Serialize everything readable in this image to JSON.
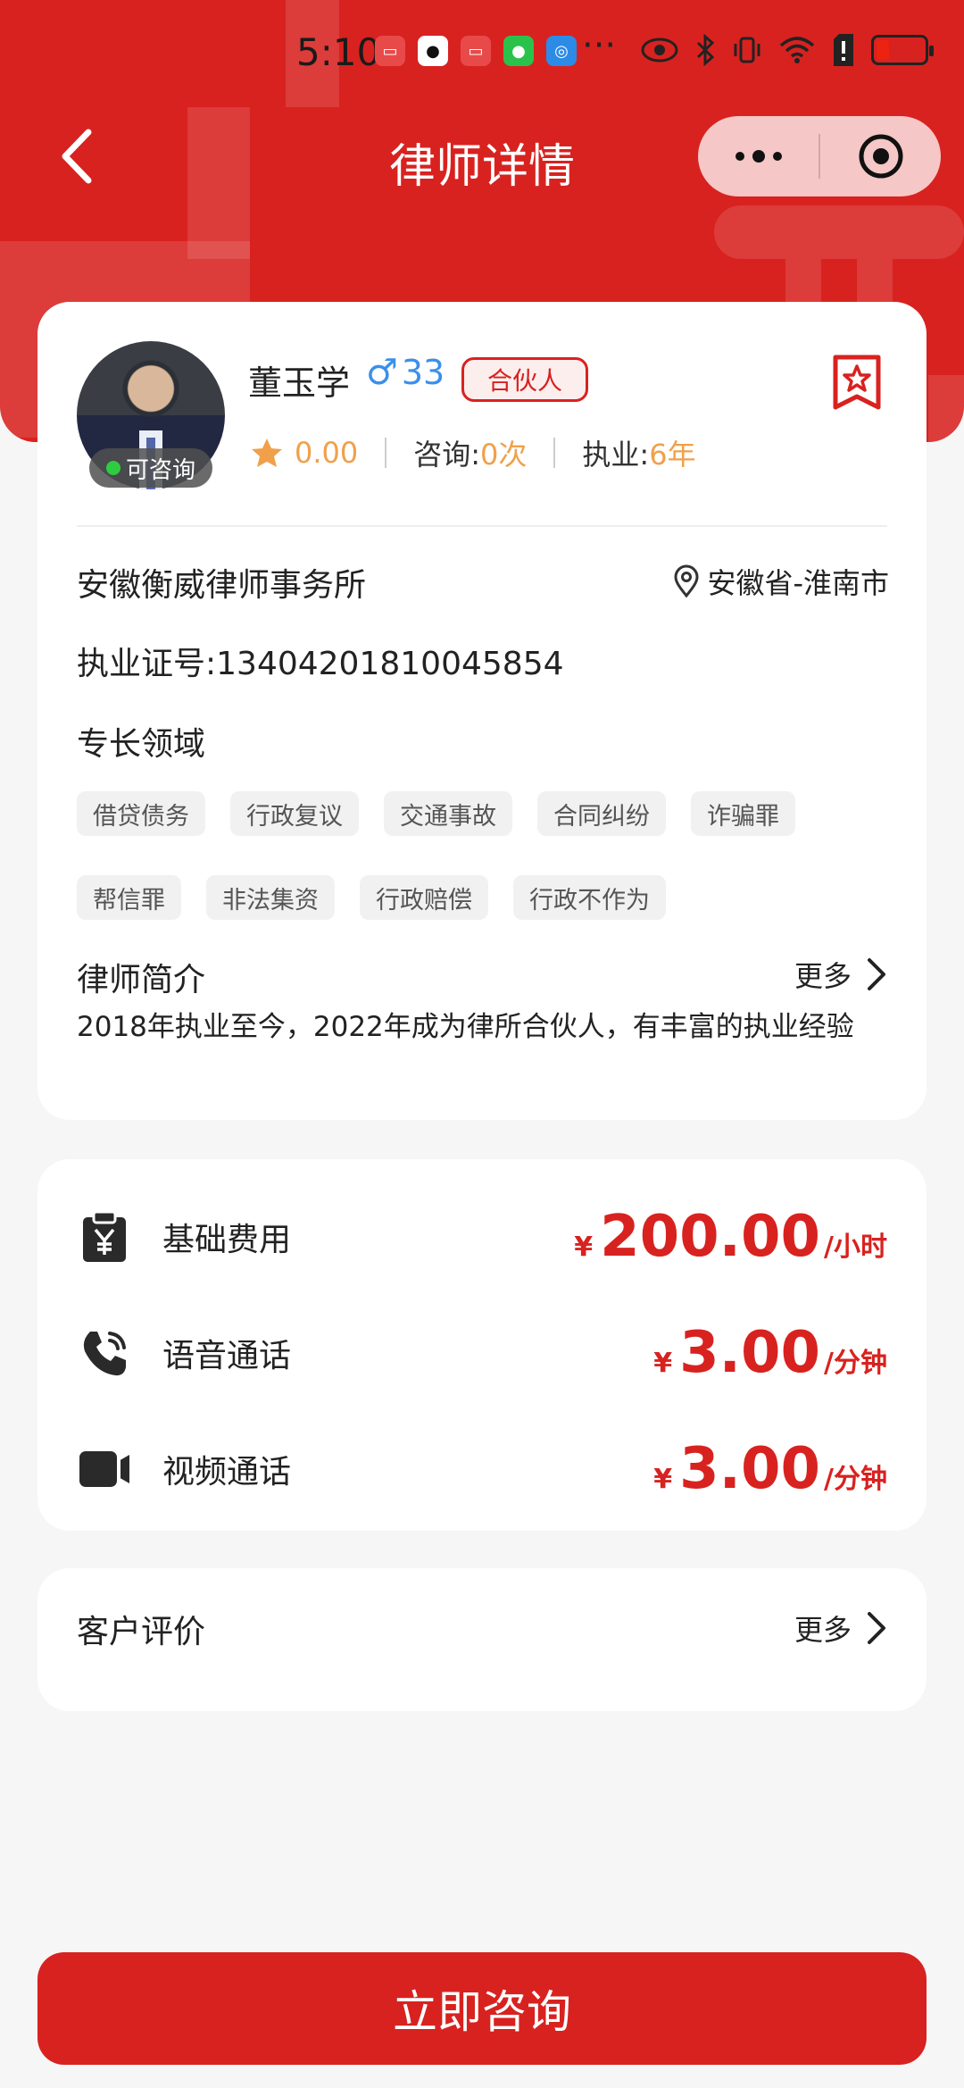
{
  "status_bar": {
    "time": "5:10",
    "more": "···"
  },
  "nav": {
    "title": "律师详情"
  },
  "lawyer": {
    "name": "董玉学",
    "gender_symbol": "♂",
    "age": "33",
    "tag": "合伙人",
    "availability": "可咨询",
    "rating": "0.00",
    "consult_label": "咨询:",
    "consult_count": "0次",
    "practice_label": "执业:",
    "practice_years": "6年",
    "firm": "安徽衡威律师事务所",
    "location": "安徽省-淮南市",
    "license": "执业证号:13404201810045854",
    "specialty_title": "专长领域",
    "specialties": [
      "借贷债务",
      "行政复议",
      "交通事故",
      "合同纠纷",
      "诈骗罪",
      "帮信罪",
      "非法集资",
      "行政赔偿",
      "行政不作为"
    ],
    "intro_title": "律师简介",
    "intro_more": "更多",
    "intro_text": "2018年执业至今，2022年成为律所合伙人，有丰富的执业经验"
  },
  "fees": [
    {
      "label": "基础费用",
      "currency": "¥",
      "amount": "200.00",
      "unit": "/小时",
      "icon": "receipt-yen-icon"
    },
    {
      "label": "语音通话",
      "currency": "¥",
      "amount": "3.00",
      "unit": "/分钟",
      "icon": "phone-icon"
    },
    {
      "label": "视频通话",
      "currency": "¥",
      "amount": "3.00",
      "unit": "/分钟",
      "icon": "video-camera-icon"
    }
  ],
  "reviews": {
    "title": "客户评价",
    "more": "更多"
  },
  "cta": {
    "label": "立即咨询"
  },
  "colors": {
    "primary": "#d8221f",
    "highlight": "#f0a04b",
    "male": "#3b8fea"
  }
}
